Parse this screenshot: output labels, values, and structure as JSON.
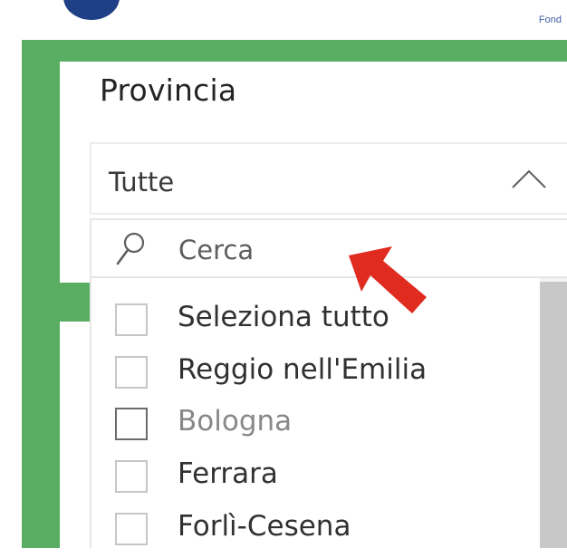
{
  "header": {
    "partial_text": "Fond"
  },
  "slicer": {
    "title": "Provincia",
    "dropdown": {
      "selected_value": "Tutte",
      "state": "expanded",
      "chevron_icon": "chevron-up-icon"
    },
    "search": {
      "placeholder": "Cerca",
      "icon": "search-icon"
    },
    "items": [
      {
        "label": "Seleziona tutto",
        "checked": false
      },
      {
        "label": "Reggio nell'Emilia",
        "checked": false
      },
      {
        "label": "Bologna",
        "checked": false
      },
      {
        "label": "Ferrara",
        "checked": false
      },
      {
        "label": "Forlì-Cesena",
        "checked": false
      }
    ]
  },
  "overlay": {
    "pointer_icon": "red-arrow-pointer-icon",
    "pointer_color": "#e02b20"
  },
  "colors": {
    "frame_green": "#5aae63",
    "logo_blue": "#1f3f86"
  }
}
